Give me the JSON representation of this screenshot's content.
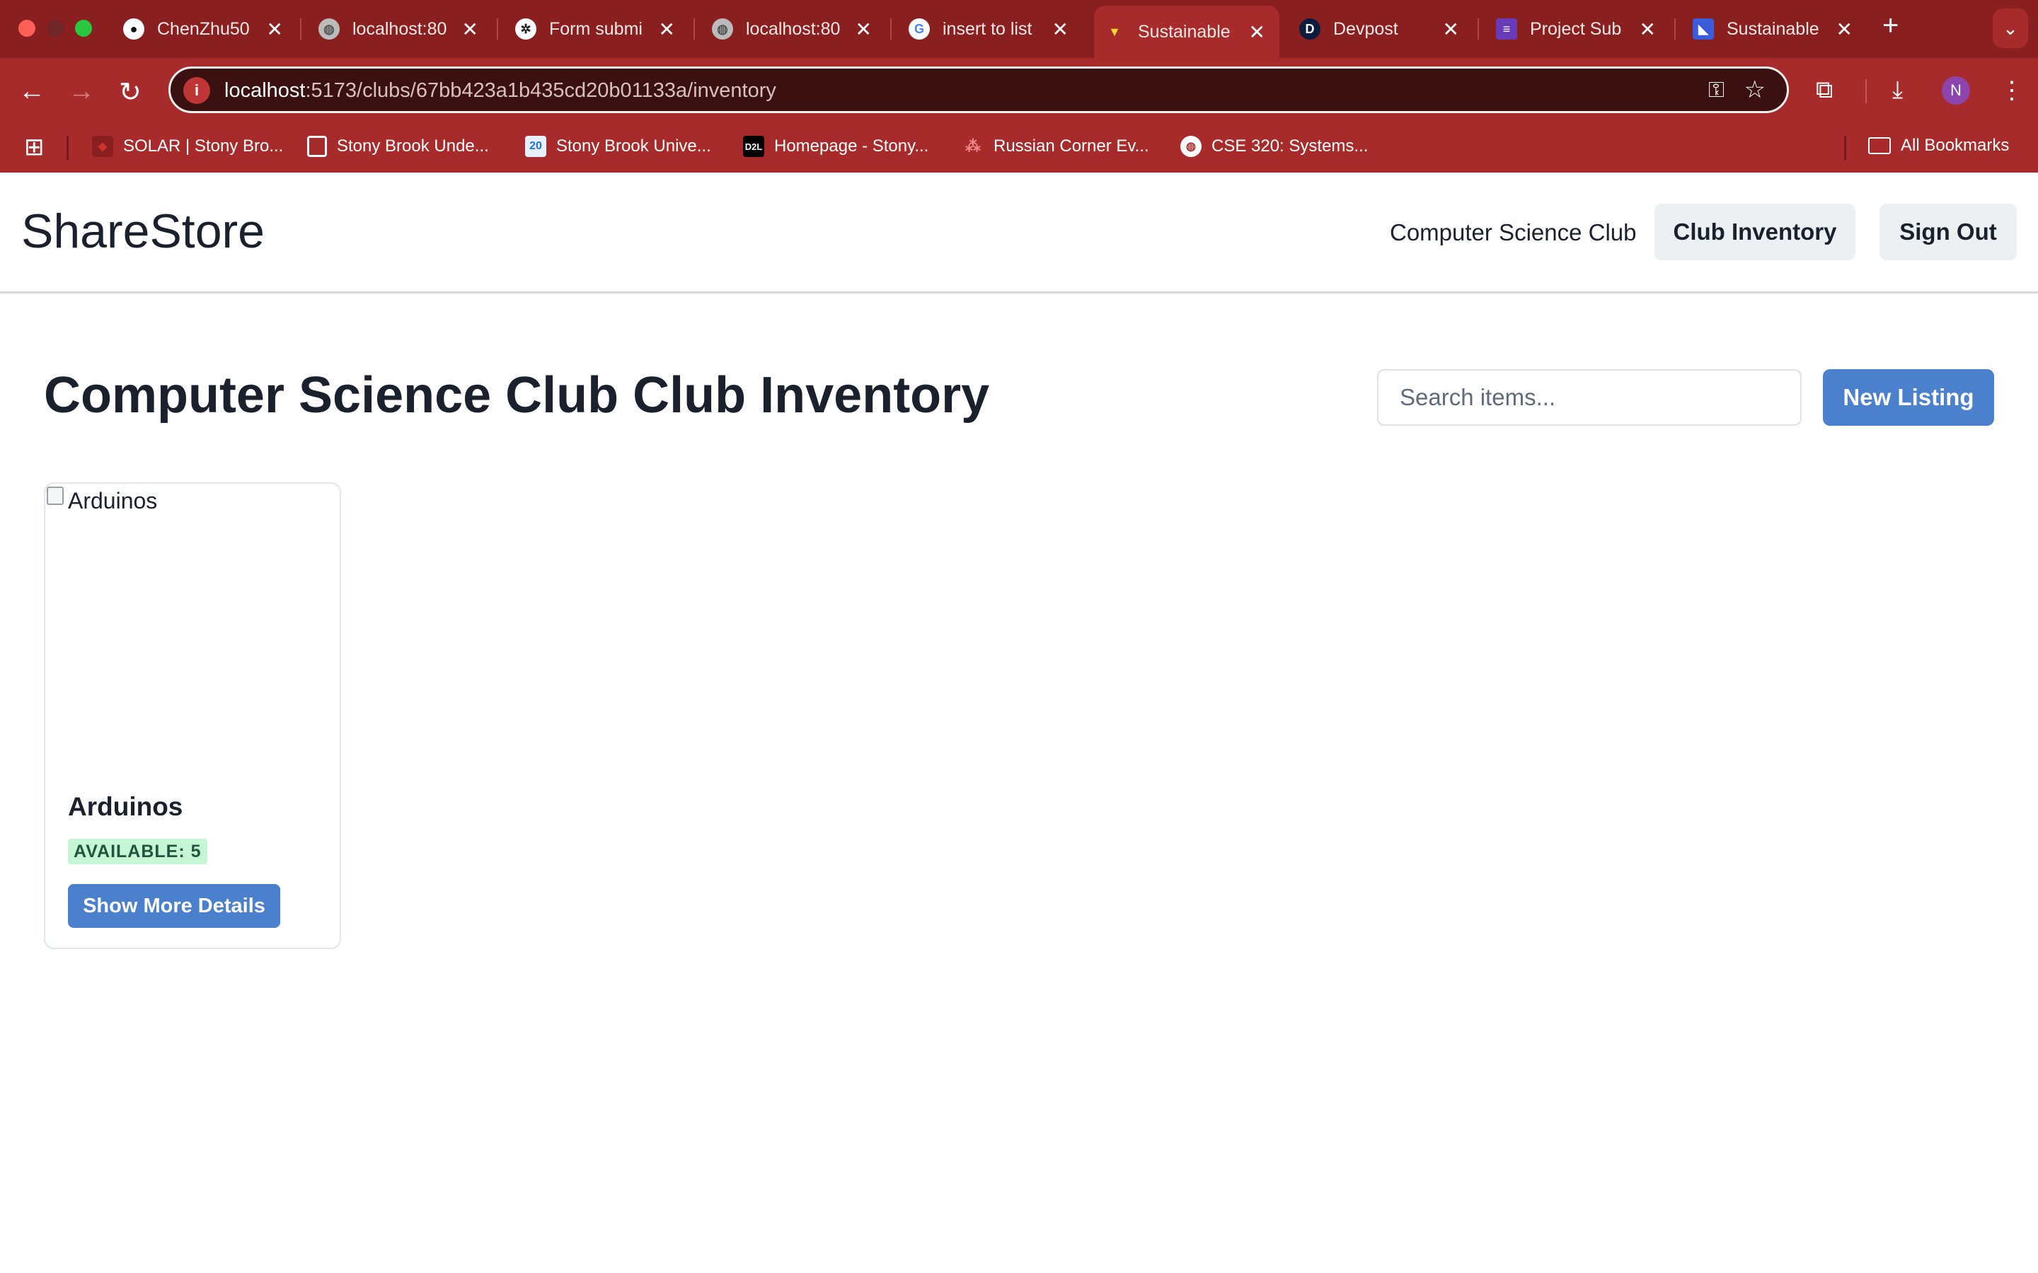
{
  "browser": {
    "tabs": [
      {
        "title": "ChenZhu50",
        "favicon": "github-icon"
      },
      {
        "title": "localhost:80",
        "favicon": "globe-icon"
      },
      {
        "title": "Form submi",
        "favicon": "openai-icon"
      },
      {
        "title": "localhost:80",
        "favicon": "globe-icon"
      },
      {
        "title": "insert to list",
        "favicon": "google-icon"
      },
      {
        "title": "Sustainable",
        "favicon": "vite-icon",
        "active": true
      },
      {
        "title": "Devpost",
        "favicon": "devpost-icon"
      },
      {
        "title": "Project Sub",
        "favicon": "forms-icon"
      },
      {
        "title": "Sustainable",
        "favicon": "app-icon"
      }
    ],
    "close_glyph": "✕",
    "new_tab_glyph": "+",
    "tab_menu_glyph": "⌄",
    "address": {
      "host": "localhost",
      "path": ":5173/clubs/67bb423a1b435cd20b01133a/inventory"
    },
    "avatar_letter": "N",
    "bookmarks": [
      {
        "label": "SOLAR | Stony Bro...",
        "icon": "solar-icon"
      },
      {
        "label": "Stony Brook Unde...",
        "icon": "shield-icon"
      },
      {
        "label": "Stony Brook Unive...",
        "icon": "calendar-icon"
      },
      {
        "label": "Homepage - Stony...",
        "icon": "d2l-icon"
      },
      {
        "label": "Russian Corner Ev...",
        "icon": "dots-icon"
      },
      {
        "label": "CSE 320: Systems...",
        "icon": "globe-icon"
      }
    ],
    "all_bookmarks_label": "All Bookmarks",
    "colors": {
      "chrome": "#a82b2b",
      "tabstrip": "#8a1f1f"
    }
  },
  "header": {
    "brand": "ShareStore",
    "nav_club": "Computer Science Club",
    "inventory_button": "Club Inventory",
    "signout_button": "Sign Out"
  },
  "main": {
    "title_club": "Computer Science Club",
    "title_suffix": "Club Inventory",
    "search_placeholder": "Search items...",
    "new_listing_button": "New Listing",
    "items": [
      {
        "image_alt": "Arduinos",
        "name": "Arduinos",
        "availability": "AVAILABLE: 5",
        "details_button": "Show More Details"
      }
    ],
    "colors": {
      "primary": "#4a80cc",
      "badge_bg": "#c6f6d5",
      "badge_text": "#22543d"
    }
  }
}
